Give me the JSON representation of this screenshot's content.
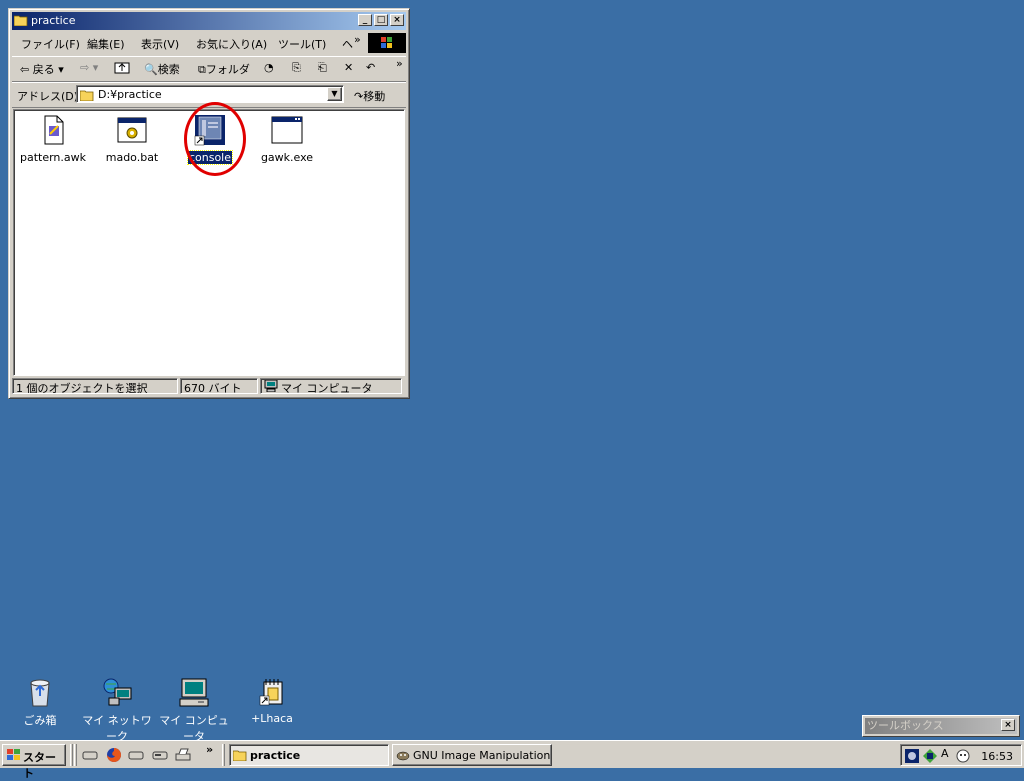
{
  "window": {
    "title": "practice",
    "menu": [
      "ファイル(F)",
      "編集(E)",
      "表示(V)",
      "お気に入り(A)",
      "ツール(T)",
      "ヘ",
      "»"
    ],
    "toolbar": {
      "back": "戻る",
      "search": "検索",
      "folders": "フォルダ",
      "more": "»"
    },
    "address": {
      "label": "アドレス(D)",
      "value": "D:¥practice",
      "go": "移動"
    },
    "files": [
      {
        "name": "pattern.awk",
        "icon": "text-file-icon",
        "selected": false
      },
      {
        "name": "mado.bat",
        "icon": "batch-file-icon",
        "selected": false
      },
      {
        "name": "console",
        "icon": "console-shortcut-icon",
        "selected": true
      },
      {
        "name": "gawk.exe",
        "icon": "exe-file-icon",
        "selected": false
      }
    ],
    "status": {
      "selection": "1 個のオブジェクトを選択",
      "size": "670 バイト",
      "zone": "マイ コンピュータ"
    }
  },
  "desktop": {
    "icons": [
      {
        "label": "ごみ箱",
        "icon": "recycle-bin-icon"
      },
      {
        "label": "マイ ネットワーク",
        "icon": "network-places-icon"
      },
      {
        "label": "マイ コンピュータ",
        "icon": "my-computer-icon"
      },
      {
        "label": "+Lhaca",
        "icon": "lhaca-shortcut-icon"
      }
    ]
  },
  "toolbox": {
    "title": "ツールボックス",
    "close": "×"
  },
  "taskbar": {
    "start": "スタート",
    "ql_more": "»",
    "tasks": [
      {
        "label": "practice",
        "active": true
      },
      {
        "label": "GNU Image Manipulation ...",
        "active": false
      }
    ],
    "clock": "16:53"
  },
  "colors": {
    "desktop": "#3a6ea5",
    "titlebar": "#0a246a",
    "highlight_circle": "#e00000"
  }
}
